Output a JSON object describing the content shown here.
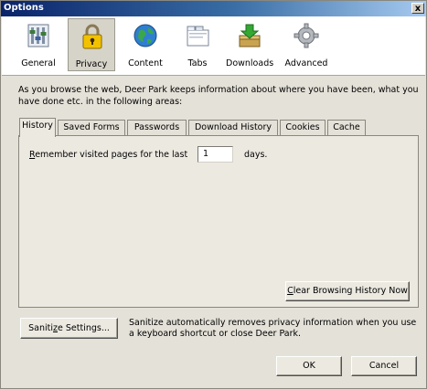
{
  "window": {
    "title": "Options",
    "close_glyph": "x"
  },
  "toolbar": {
    "items": [
      {
        "label": "General",
        "icon": "general-icon"
      },
      {
        "label": "Privacy",
        "icon": "lock-icon"
      },
      {
        "label": "Content",
        "icon": "globe-icon"
      },
      {
        "label": "Tabs",
        "icon": "tabs-icon"
      },
      {
        "label": "Downloads",
        "icon": "downloads-icon"
      },
      {
        "label": "Advanced",
        "icon": "gear-icon"
      }
    ],
    "selected": "Privacy"
  },
  "description": "As you browse the web, Deer Park keeps information about where you have been, what you have done etc. in the following areas:",
  "tabs": [
    {
      "label": "History",
      "active": true
    },
    {
      "label": "Saved Forms"
    },
    {
      "label": "Passwords"
    },
    {
      "label": "Download History"
    },
    {
      "label": "Cookies"
    },
    {
      "label": "Cache"
    }
  ],
  "history": {
    "remember_prefix_underlined": "R",
    "remember_prefix_rest": "emember visited pages for the last",
    "days_value": "1",
    "days_label": "days.",
    "clear_button_underlined": "C",
    "clear_button_rest": "lear Browsing History Now"
  },
  "sanitize": {
    "button_pre": "Saniti",
    "button_underlined": "z",
    "button_post": "e Settings...",
    "text": "Sanitize automatically removes privacy information when you use a keyboard shortcut or close Deer Park."
  },
  "buttons": {
    "ok": "OK",
    "cancel": "Cancel"
  },
  "colors": {
    "title_bar": "#0a246a",
    "dialog_bg": "#e4e1d8",
    "toolbar_bg": "#ffffff"
  }
}
